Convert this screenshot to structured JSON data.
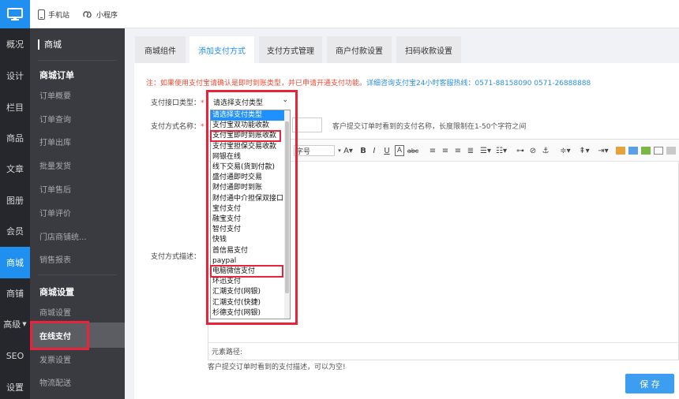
{
  "topbar": {
    "mobile_label": "手机站",
    "miniprogram_label": "小程序"
  },
  "rail": {
    "items": [
      "概况",
      "设计",
      "栏目",
      "商品",
      "文章",
      "图册",
      "会员",
      "商城",
      "商铺",
      "高级",
      "SEO",
      "设置"
    ]
  },
  "submenu": {
    "title": "商城",
    "group1_head": "商城订单",
    "group1": [
      "订单概要",
      "订单查询",
      "打单出库",
      "批量发货",
      "订单售后",
      "订单评价",
      "门店商铺统...",
      "销售报表"
    ],
    "group2_head": "商城设置",
    "group2": [
      "商城设置",
      "在线支付",
      "发票设置",
      "物流配送"
    ]
  },
  "tabs": [
    "商城组件",
    "添加支付方式",
    "支付方式管理",
    "商户付款设置",
    "扫码收款设置"
  ],
  "notice": {
    "red": "注：如果使用支付宝请确认是即时到账类型，并已申请开通支付功能。",
    "blue": "详细咨询支付宝24小时客服热线：0571-88158090 0571-26888888"
  },
  "form": {
    "type_label": "支付接口类型：",
    "required_mark": "*",
    "name_label": "支付方式名称：",
    "name_hint": "客户提交订单时看到的支付名称，长度限制在1-50个字符之间",
    "desc_label": "支付方式描述：",
    "desc_hint": "客户提交订单时看到的支付描述，可以为空!",
    "path_label": "元素路径:",
    "select_value": "请选择支付类型",
    "save_label": "保 存"
  },
  "dropdown_options": [
    "请选择支付类型",
    "支付宝双功能收款",
    "支付宝即时到账收款",
    "支付宝担保交易收款",
    "网银在线",
    "线下交易(货到付款)",
    "盛付通即时交易",
    "财付通即时到账",
    "财付通中介担保双接口",
    "宝付支付",
    "融宝支付",
    "智付支付",
    "快钱",
    "首信易支付",
    "paypal",
    "电脑微信支付",
    "环迅支付",
    "汇潮支付(网银)",
    "汇潮支付(快捷)",
    "杉德支付(网银)"
  ],
  "editor": {
    "font_size_label": "字号",
    "bold": "B",
    "italic": "I",
    "underline": "U"
  }
}
